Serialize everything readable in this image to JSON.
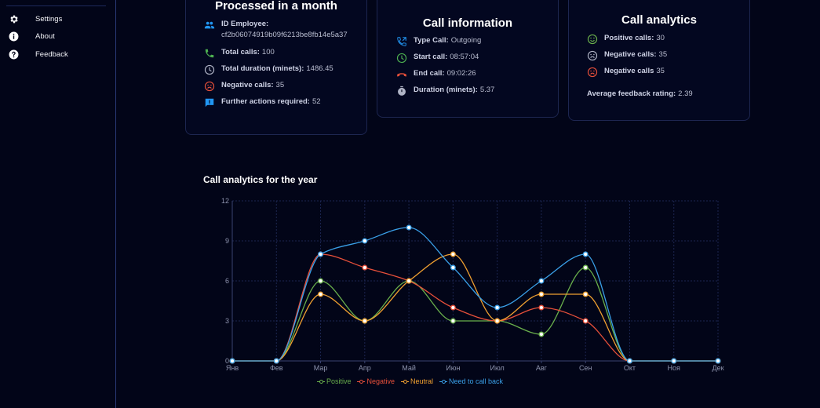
{
  "sidebar": {
    "items": [
      {
        "label": "Settings",
        "icon": "gear-icon"
      },
      {
        "label": "About",
        "icon": "info-icon"
      },
      {
        "label": "Feedback",
        "icon": "help-icon"
      }
    ]
  },
  "processed": {
    "title": "Processed in a month",
    "id_label": "ID Employee:",
    "id_value": "cf2b06074919b09f6213be8fb14e5a37",
    "total_calls_label": "Total calls:",
    "total_calls_value": "100",
    "total_duration_label": "Total duration (minets):",
    "total_duration_value": "1486.45",
    "negative_calls_label": "Negative calls:",
    "negative_calls_value": "35",
    "further_label": "Further actions required:",
    "further_value": "52"
  },
  "call_info": {
    "title": "Call information",
    "type_label": "Type Call:",
    "type_value": "Outgoing",
    "start_label": "Start call:",
    "start_value": "08:57:04",
    "end_label": "End call:",
    "end_value": "09:02:26",
    "duration_label": "Duration (minets):",
    "duration_value": "5.37"
  },
  "call_analytics": {
    "title": "Call analytics",
    "positive_label": "Positive calls:",
    "positive_value": "30",
    "negative1_label": "Negative calls:",
    "negative1_value": "35",
    "negative2_label": "Negative calls",
    "negative2_value": "35",
    "rating_label": "Average feedback rating:",
    "rating_value": "2.39"
  },
  "colors": {
    "positive": "#6ab04c",
    "negative": "#e8503a",
    "neutral": "#f0a030",
    "callback": "#3aa0e8",
    "accent": "#2196f3"
  },
  "chart_section": {
    "title": "Call analytics for the year"
  },
  "chart_data": {
    "type": "line",
    "categories": [
      "Янв",
      "Фев",
      "Мар",
      "Апр",
      "Май",
      "Июн",
      "Июл",
      "Авг",
      "Сен",
      "Окт",
      "Ноя",
      "Дек"
    ],
    "ylim": [
      0,
      12
    ],
    "yticks": [
      0,
      3,
      6,
      9,
      12
    ],
    "grid": true,
    "legend": "bottom",
    "series": [
      {
        "name": "Positive",
        "color": "#6ab04c",
        "values": [
          0,
          0,
          6,
          3,
          6,
          3,
          3,
          2,
          7,
          0,
          0,
          0
        ]
      },
      {
        "name": "Negative",
        "color": "#e8503a",
        "values": [
          0,
          0,
          8,
          7,
          6,
          4,
          3,
          4,
          3,
          0,
          0,
          0
        ]
      },
      {
        "name": "Neutral",
        "color": "#f0a030",
        "values": [
          0,
          0,
          5,
          3,
          6,
          8,
          3,
          5,
          5,
          0,
          0,
          0
        ]
      },
      {
        "name": "Need to call back",
        "color": "#3aa0e8",
        "values": [
          0,
          0,
          8,
          9,
          10,
          7,
          4,
          6,
          8,
          0,
          0,
          0
        ]
      }
    ]
  }
}
